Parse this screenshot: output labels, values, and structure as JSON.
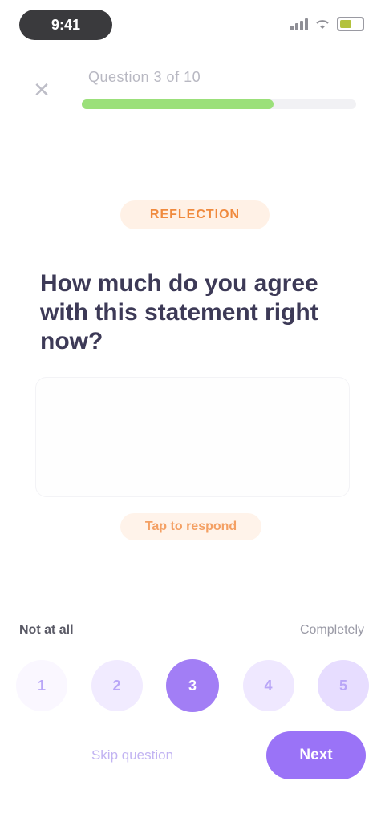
{
  "status_bar": {
    "time": "9:41",
    "battery_level": 0.6,
    "accent_battery": "#b3c23c"
  },
  "header": {
    "close_icon": "close-icon",
    "progress_text": "Question 3 of 10",
    "progress_fraction": 0.7,
    "progress_color": "#9be07a"
  },
  "question": {
    "badge": "REFLECTION",
    "text": "How much do you agree with this statement right now?",
    "hint": "Tap to respond"
  },
  "rating": {
    "low_label": "Not at all",
    "high_label": "Completely",
    "options": [
      "1",
      "2",
      "3",
      "4",
      "5"
    ],
    "selected_index": 2,
    "accent": "#9a73f7"
  },
  "footer": {
    "skip_label": "Skip question",
    "next_label": "Next"
  }
}
